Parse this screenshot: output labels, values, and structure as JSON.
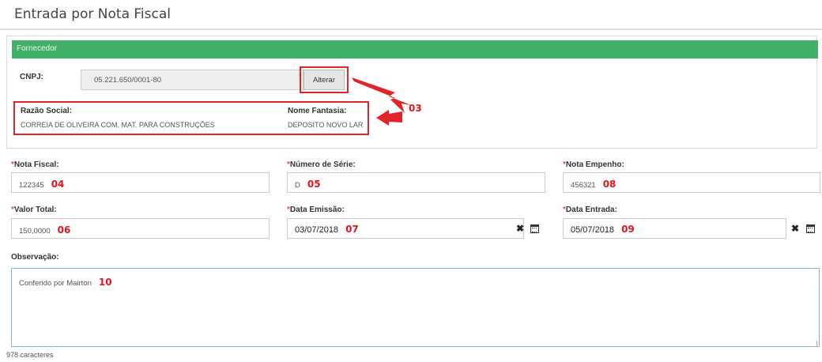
{
  "page": {
    "title": "Entrada por Nota Fiscal"
  },
  "fornecedor": {
    "header": "Fornecedor",
    "cnpj_label": "CNPJ:",
    "cnpj_value": "05.221.650/0001-80",
    "alterar_label": "Alterar",
    "razao_label": "Razão Social:",
    "razao_value": "CORREIA DE OLIVEIRA COM. MAT. PARA CONSTRUÇÕES",
    "fantasia_label": "Nome Fantasia:",
    "fantasia_value": "DEPOSITO NOVO LAR",
    "annotation": "03"
  },
  "fields": {
    "required_mark": "*",
    "nota_fiscal": {
      "label": "Nota Fiscal:",
      "value": "122345",
      "annotation": "04"
    },
    "numero_serie": {
      "label": "Número de Série:",
      "value": "D",
      "annotation": "05"
    },
    "nota_empenho": {
      "label": "Nota Empenho:",
      "value": "456321",
      "annotation": "08"
    },
    "valor_total": {
      "label": "Valor Total:",
      "value": "150,0000",
      "annotation": "06"
    },
    "data_emissao": {
      "label": "Data Emissão:",
      "value": "03/07/2018",
      "annotation": "07"
    },
    "data_entrada": {
      "label": "Data Entrada:",
      "value": "05/07/2018",
      "annotation": "09"
    },
    "observacao": {
      "label": "Observação:",
      "value": "Conferido por Mairton",
      "annotation": "10"
    },
    "counter": "978 caracteres"
  },
  "colors": {
    "panel_header": "#42b068",
    "highlight": "#e2232a",
    "required": "#d9534f"
  },
  "icons": [
    "clear-icon",
    "calendar-icon",
    "lightning-arrow-icon",
    "left-arrow-icon"
  ]
}
